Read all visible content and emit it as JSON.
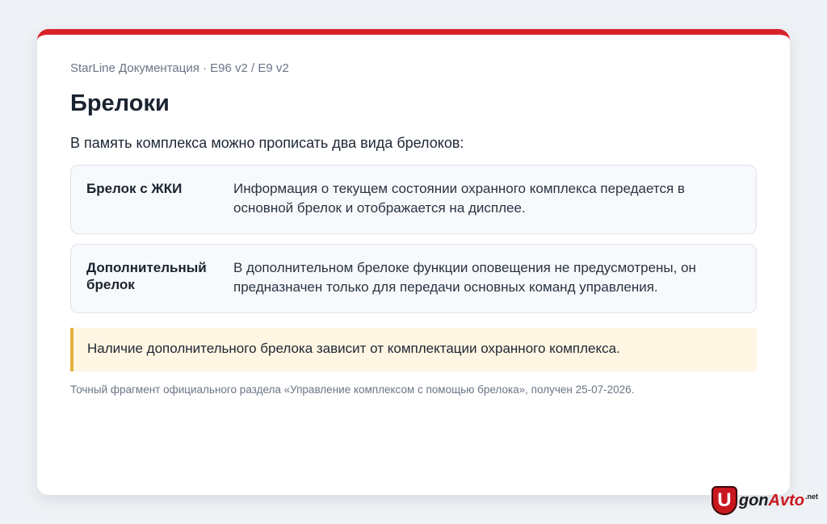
{
  "breadcrumb": "StarLine Документация · E96 v2 / E9 v2",
  "title": "Брелоки",
  "intro": "В память комплекса можно прописать два вида брелоков:",
  "fobs": [
    {
      "name": "Брелок с ЖКИ",
      "description": "Информация о текущем состоянии охранного комплекса передается в основной брелок и отображается на дисплее."
    },
    {
      "name": "Дополнительный брелок",
      "description": "В дополнительном брелоке функции оповещения не предусмотрены, он предназначен только для передачи основных команд управления."
    }
  ],
  "note": "Наличие дополнительного брелока зависит от комплектации охранного комплекса.",
  "source": "Точный фрагмент официального раздела «Управление комплексом с помощью брелока», получен 25-07-2026.",
  "watermark": {
    "letter": "U",
    "part1": "gon",
    "part2": "Avto",
    "suffix": ".net"
  },
  "colors": {
    "accent": "#d8232a",
    "note_border": "#e3b13e",
    "note_background": "#fff6e3"
  }
}
